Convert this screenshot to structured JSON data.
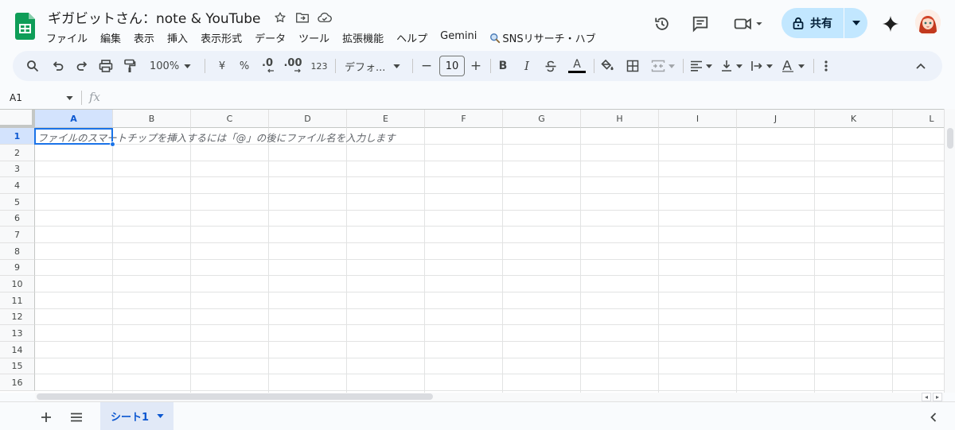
{
  "header": {
    "title": "ギガビットさん：note & YouTube",
    "menu": [
      "ファイル",
      "編集",
      "表示",
      "挿入",
      "表示形式",
      "データ",
      "ツール",
      "拡張機能",
      "ヘルプ",
      "Gemini"
    ],
    "addon_menu": "SNSリサーチ・ハブ",
    "share_label": "共有"
  },
  "toolbar": {
    "zoom": "100%",
    "currency": "¥",
    "percent": "%",
    "dec_decrease": ".0",
    "dec_increase": ".00",
    "number_format": "123",
    "font_family": "デフォ...",
    "font_size": "10",
    "bold": "B",
    "italic": "I",
    "text_color_glyph": "A",
    "minus": "−",
    "plus": "+"
  },
  "formula_bar": {
    "name_box": "A1",
    "fx": "fx"
  },
  "grid": {
    "columns": [
      "A",
      "B",
      "C",
      "D",
      "E",
      "F",
      "G",
      "H",
      "I",
      "J",
      "K",
      "L"
    ],
    "rows": [
      "1",
      "2",
      "3",
      "4",
      "5",
      "6",
      "7",
      "8",
      "9",
      "10",
      "11",
      "12",
      "13",
      "14",
      "15",
      "16"
    ],
    "selected_cell": "A1",
    "a1_placeholder": "ファイルのスマートチップを挿入するには「@」の後にファイル名を入力します"
  },
  "sheets": {
    "active": "シート1"
  },
  "colors": {
    "accent": "#0b57d0",
    "share_bg": "#c2e7ff",
    "toolbar_bg": "#edf2fa",
    "sheets_green": "#0f9d58"
  }
}
